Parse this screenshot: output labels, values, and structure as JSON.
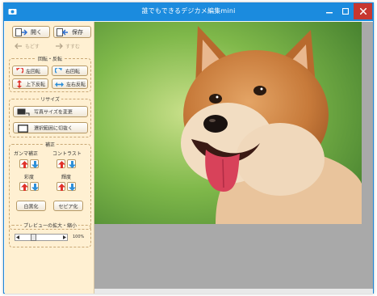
{
  "window": {
    "title": "誰でもできるデジカメ編集mini"
  },
  "toolbar": {
    "open_label": "開く",
    "save_label": "保存",
    "undo_label": "もどす",
    "redo_label": "すすむ"
  },
  "rotate": {
    "title": "回転・反転",
    "rotate_left_label": "左回転",
    "rotate_right_label": "右回転",
    "flip_vertical_label": "上下反転",
    "flip_horizontal_label": "左右反転"
  },
  "resize": {
    "title": "リサイズ",
    "resize_label": "写真サイズを変更",
    "crop_label": "選択範囲に切抜く"
  },
  "adjust": {
    "title": "補正",
    "gamma_label": "ガンマ補正",
    "contrast_label": "コントラスト",
    "brightness_label": "彩度",
    "saturation_label": "輝度",
    "bw_label": "白黒化",
    "sepia_label": "セピア化"
  },
  "preview": {
    "title": "プレビューの拡大・縮小",
    "zoom_text": "100%",
    "zoom_level": 0.25
  },
  "colors": {
    "titlebar": "#1b8bde",
    "panel": "#fff0d2",
    "viewer_bg": "#a9a9a9",
    "arrow_up": "#e0322a",
    "arrow_down": "#2d8fd8"
  }
}
